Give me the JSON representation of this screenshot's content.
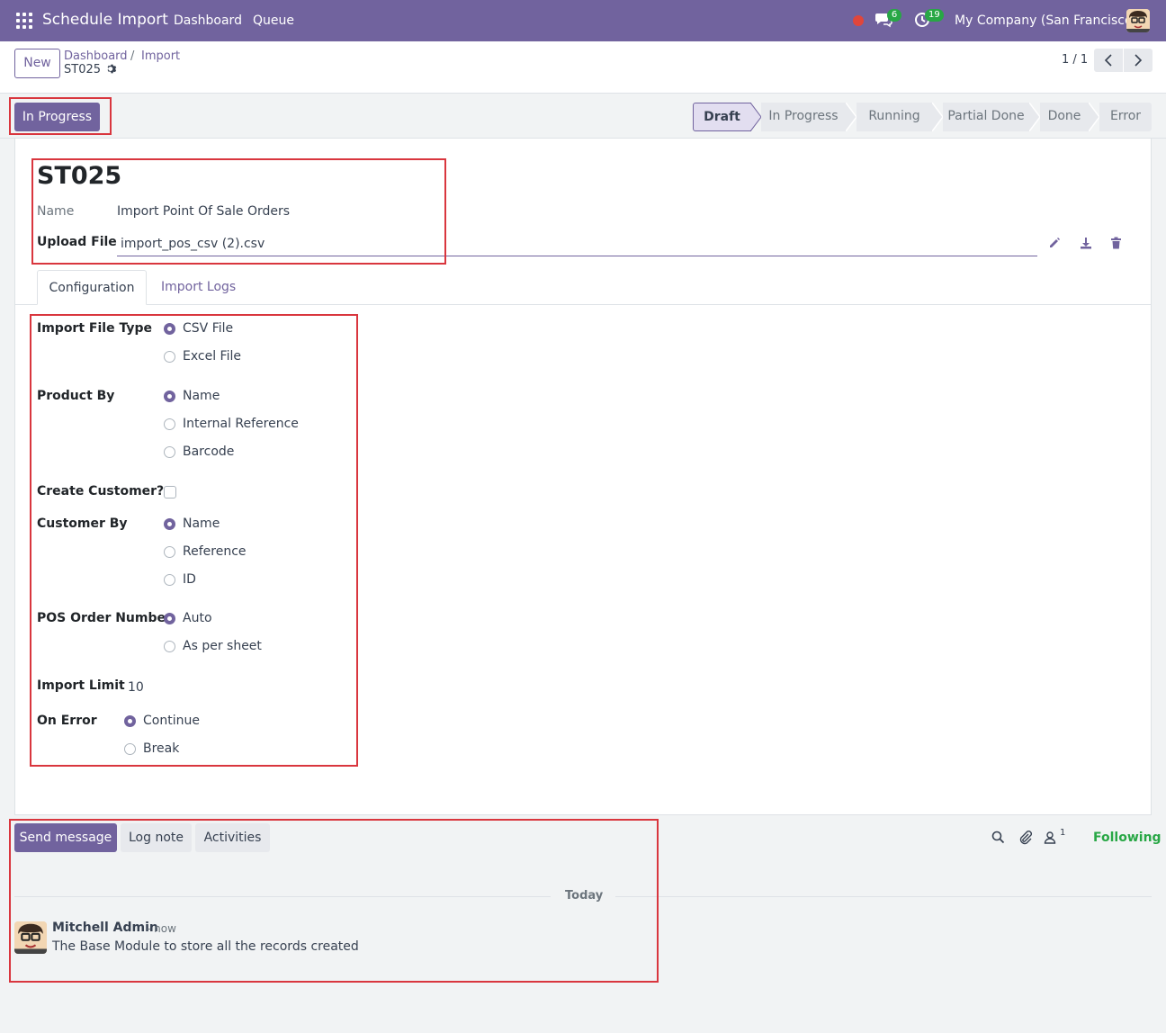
{
  "navbar": {
    "app_title": "Schedule Import",
    "menu": [
      "Dashboard",
      "Queue"
    ],
    "messages_count": "6",
    "activities_count": "19",
    "company": "My Company (San Francisco)",
    "brand_color": "#71639e"
  },
  "control_panel": {
    "new_label": "New",
    "breadcrumb": [
      "Dashboard",
      "Import"
    ],
    "breadcrumb_sep": "/",
    "record": "ST025",
    "pager": "1 / 1"
  },
  "status": {
    "action_button": "In Progress",
    "stages": [
      "Draft",
      "In Progress",
      "Running",
      "Partial Done",
      "Done",
      "Error"
    ],
    "active_stage": "Draft"
  },
  "form": {
    "title": "ST025",
    "name_label": "Name",
    "name_value": "Import Point Of Sale Orders",
    "upload_label": "Upload File",
    "upload_value": "import_pos_csv (2).csv",
    "tabs": [
      "Configuration",
      "Import Logs"
    ],
    "fields": {
      "file_type": {
        "label": "Import File Type",
        "options": [
          "CSV File",
          "Excel File"
        ],
        "selected": "CSV File"
      },
      "product_by": {
        "label": "Product By",
        "options": [
          "Name",
          "Internal Reference",
          "Barcode"
        ],
        "selected": "Name"
      },
      "create_customer": {
        "label": "Create Customer?",
        "checked": false
      },
      "customer_by": {
        "label": "Customer By",
        "options": [
          "Name",
          "Reference",
          "ID"
        ],
        "selected": "Name"
      },
      "pos_order_number": {
        "label": "POS Order Number",
        "options": [
          "Auto",
          "As per sheet"
        ],
        "selected": "Auto"
      },
      "import_limit": {
        "label": "Import Limit",
        "value": "10"
      },
      "on_error": {
        "label": "On Error",
        "options": [
          "Continue",
          "Break"
        ],
        "selected": "Continue"
      }
    }
  },
  "chatter": {
    "send_message": "Send message",
    "log_note": "Log note",
    "activities": "Activities",
    "followers_count": "1",
    "following": "Following",
    "today": "Today",
    "message": {
      "author": "Mitchell Admin",
      "time": "- now",
      "body": "The Base Module to store all the records created"
    }
  }
}
